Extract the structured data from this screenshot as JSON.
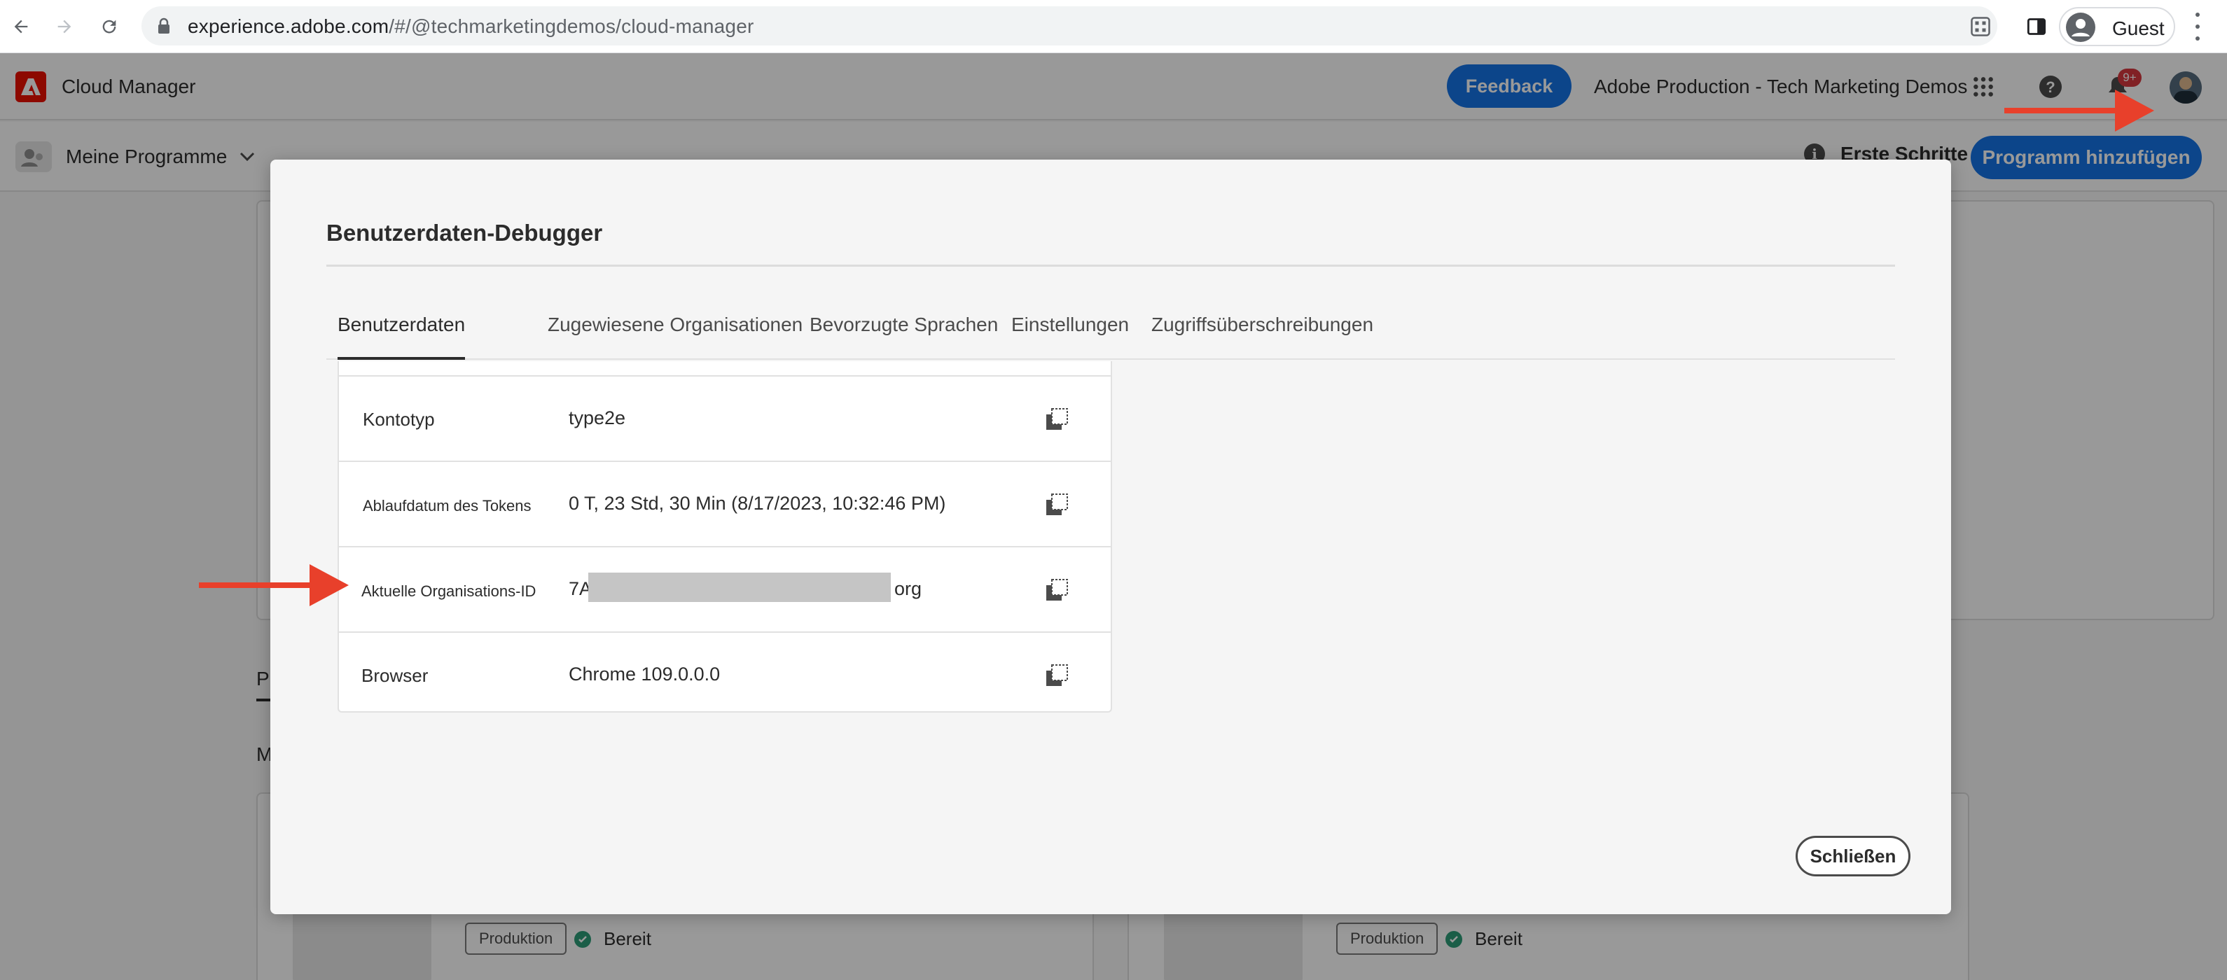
{
  "browser": {
    "url_host": "experience.adobe.com",
    "url_path": "/#/@techmarketingdemos/cloud-manager",
    "profile_label": "Guest"
  },
  "app": {
    "title": "Cloud Manager",
    "feedback_label": "Feedback",
    "org_name": "Adobe Production - Tech Marketing Demos",
    "notification_badge": "9+"
  },
  "subheader": {
    "programs_label": "Meine Programme",
    "first_steps_label": "Erste Schritte",
    "add_program_label": "Programm hinzufügen"
  },
  "background": {
    "tab_letter": "P",
    "section_letter": "M",
    "cards": [
      {
        "env_tag": "Produktion",
        "status": "Bereit"
      },
      {
        "env_tag": "Produktion",
        "status": "Bereit"
      }
    ]
  },
  "dialog": {
    "title": "Benutzerdaten-Debugger",
    "tabs": [
      {
        "label": "Benutzerdaten",
        "active": true
      },
      {
        "label": "Zugewiesene Organisationen",
        "active": false
      },
      {
        "label": "Bevorzugte Sprachen",
        "active": false
      },
      {
        "label": "Einstellungen",
        "active": false
      },
      {
        "label": "Zugriffsüberschreibungen",
        "active": false
      }
    ],
    "rows": [
      {
        "key": "Kontotyp",
        "value": "type2e"
      },
      {
        "key": "Ablaufdatum des Tokens",
        "value": "0 T, 23 Std, 30 Min (8/17/2023, 10:32:46 PM)"
      },
      {
        "key": "Aktuelle Organisations-ID",
        "value_prefix": "7A",
        "value_suffix": "org",
        "redacted": true
      },
      {
        "key": "Browser",
        "value": "Chrome 109.0.0.0"
      }
    ],
    "close_label": "Schließen"
  },
  "colors": {
    "accent_blue": "#1473e6",
    "adobe_red": "#eb1000",
    "annotation_arrow": "#e8402b",
    "status_green": "#2d9d78",
    "badge_red": "#d7373f"
  }
}
